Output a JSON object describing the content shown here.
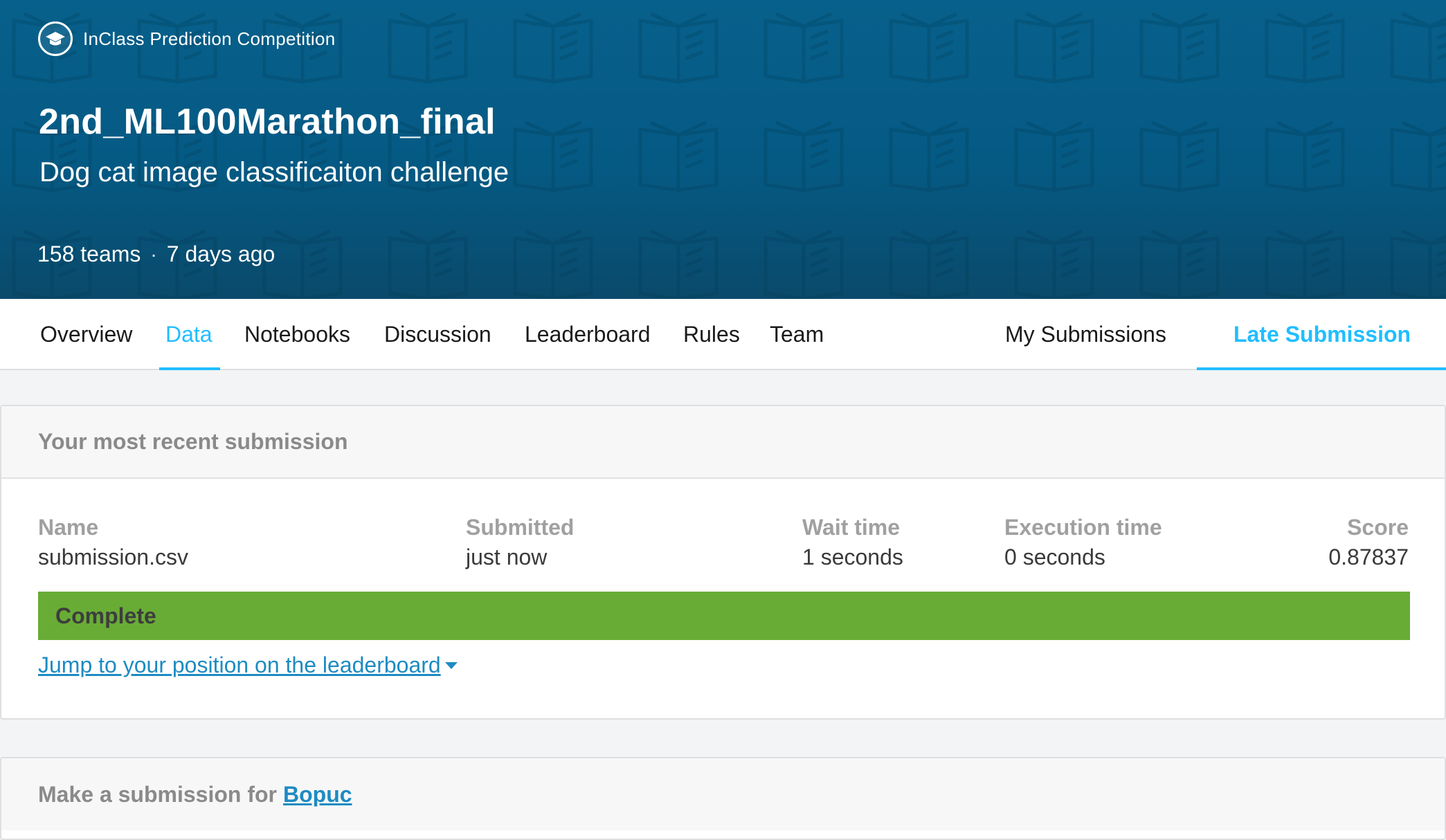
{
  "hero": {
    "badge_label": "InClass Prediction Competition",
    "title": "2nd_ML100Marathon_final",
    "subtitle": "Dog cat image classificaiton challenge",
    "teams": "158 teams",
    "separator": "·",
    "time_ago": "7 days ago",
    "badge_icon": "graduation-cap-icon",
    "pattern_icon": "open-book-icon",
    "background_color": "#07608b"
  },
  "tabs": {
    "left": [
      "Overview",
      "Data",
      "Notebooks",
      "Discussion",
      "Leaderboard",
      "Rules",
      "Team"
    ],
    "right": [
      "My Submissions",
      "Late Submission"
    ],
    "highlight_color": "#20beff"
  },
  "recent": {
    "header": "Your most recent submission",
    "columns": {
      "name": {
        "label": "Name",
        "value": "submission.csv"
      },
      "submitted": {
        "label": "Submitted",
        "value": "just now"
      },
      "wait": {
        "label": "Wait time",
        "value": "1 seconds"
      },
      "execution": {
        "label": "Execution time",
        "value": "0 seconds"
      },
      "score": {
        "label": "Score",
        "value": "0.87837"
      }
    },
    "status": "Complete",
    "status_color": "#68ac36",
    "jump_link": "Jump to your position on the leaderboard "
  },
  "make_submission": {
    "prefix": "Make a submission for",
    "user": "Bopuc"
  }
}
